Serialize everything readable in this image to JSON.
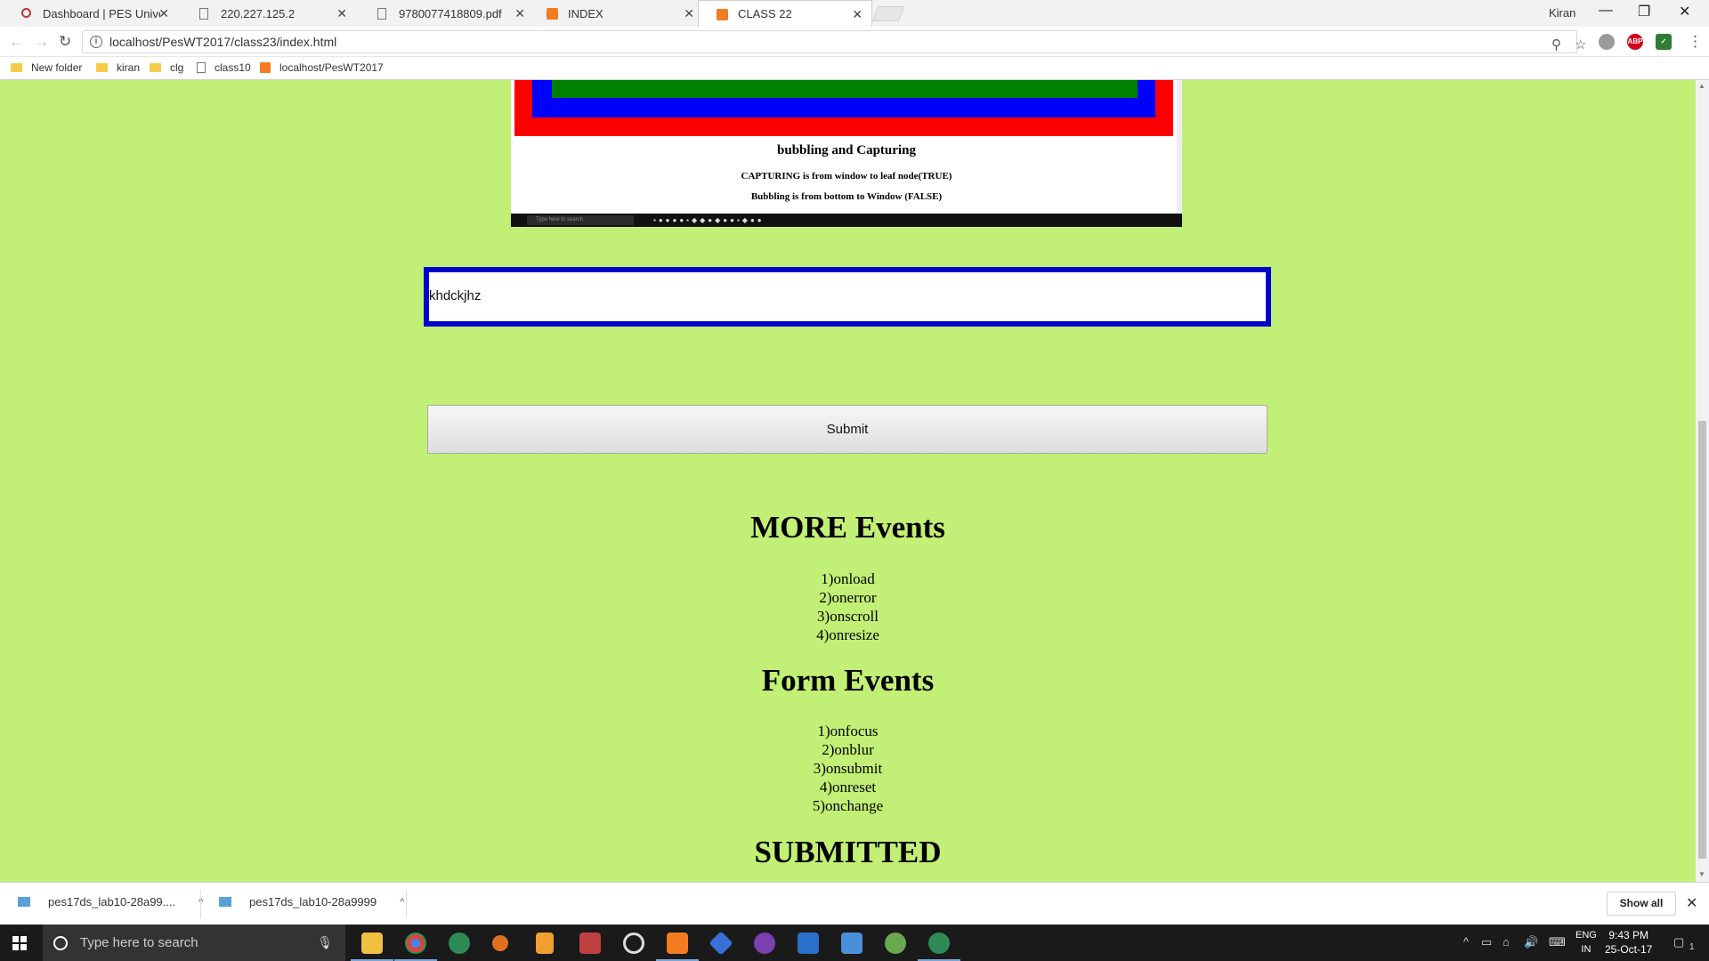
{
  "browser": {
    "tabs": [
      {
        "label": "Dashboard | PES Univers",
        "active": false,
        "icon": "moodle-icon"
      },
      {
        "label": "220.227.125.2",
        "active": false,
        "icon": "page-icon"
      },
      {
        "label": "9780077418809.pdf",
        "active": false,
        "icon": "page-icon"
      },
      {
        "label": "INDEX",
        "active": false,
        "icon": "xampp-icon"
      },
      {
        "label": "CLASS 22",
        "active": true,
        "icon": "xampp-icon"
      }
    ],
    "profile_name": "Kiran",
    "url": "localhost/PesWT2017/class23/index.html",
    "bookmarks": [
      {
        "label": "New folder",
        "type": "folder"
      },
      {
        "label": "kiran",
        "type": "folder"
      },
      {
        "label": "clg",
        "type": "folder"
      },
      {
        "label": "class10",
        "type": "page"
      },
      {
        "label": "localhost/PesWT2017",
        "type": "xampp"
      }
    ],
    "extensions": {
      "abp": "ABP"
    }
  },
  "page": {
    "embedded_screenshot": {
      "title": "bubbling and Capturing",
      "line1": "CAPTURING is from window to leaf node(TRUE)",
      "line2": "Bubbling is from bottom to Window (FALSE)",
      "taskbar_search": "Type here to search",
      "colors": {
        "outer": "#ff0000",
        "middle": "#0000ff",
        "inner": "#008000"
      }
    },
    "input_value": "khdckjhz",
    "submit_label": "Submit",
    "more_events": {
      "heading": "MORE Events",
      "items": [
        "1)onload",
        "2)onerror",
        "3)onscroll",
        "4)onresize"
      ]
    },
    "form_events": {
      "heading": "Form Events",
      "items": [
        "1)onfocus",
        "2)onblur",
        "3)onsubmit",
        "4)onreset",
        "5)onchange"
      ]
    },
    "submitted_text": "SUBMITTED",
    "background_color": "#c2ef75"
  },
  "downloads": {
    "items": [
      "pes17ds_lab10-28a99....",
      "pes17ds_lab10-28a9999"
    ],
    "show_all": "Show all"
  },
  "taskbar": {
    "search_placeholder": "Type here to search",
    "language": "ENG",
    "region": "IN",
    "time": "9:43 PM",
    "date": "25-Oct-17",
    "notification_count": "1"
  }
}
